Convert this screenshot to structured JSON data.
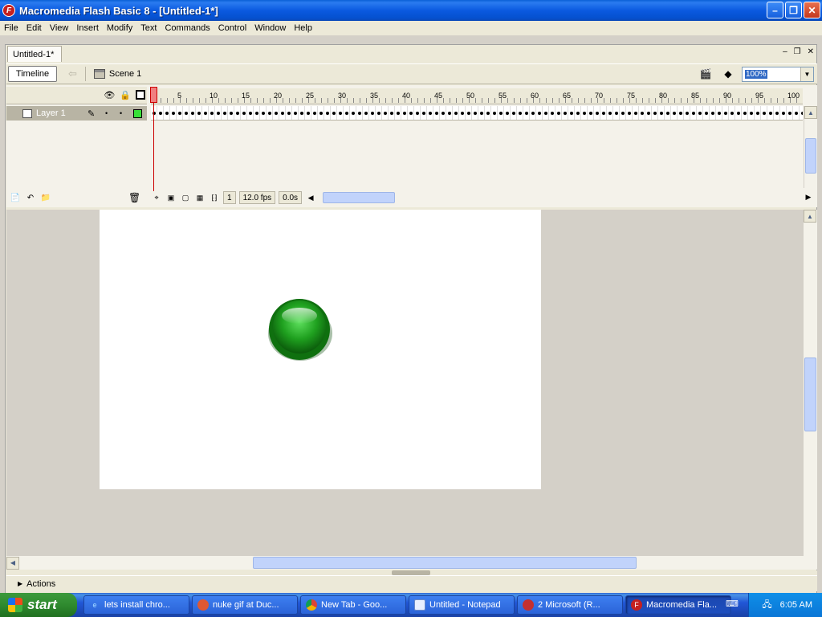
{
  "window": {
    "title": "Macromedia Flash Basic 8 - [Untitled-1*]",
    "app_icon": "F",
    "minimize": "–",
    "maximize": "❐",
    "close": "✕"
  },
  "menu": [
    "File",
    "Edit",
    "View",
    "Insert",
    "Modify",
    "Text",
    "Commands",
    "Control",
    "Window",
    "Help"
  ],
  "document": {
    "tab_label": "Untitled-1*",
    "minimize": "–",
    "restore": "❐",
    "close": "✕"
  },
  "edit_bar": {
    "timeline_label": "Timeline",
    "scene_label": "Scene 1",
    "zoom": "100%"
  },
  "timeline": {
    "layer_name": "Layer 1",
    "ruler_numbers": [
      "1",
      "5",
      "10",
      "15",
      "20",
      "25",
      "30",
      "35",
      "40",
      "45",
      "50",
      "55",
      "60",
      "65",
      "70",
      "75",
      "80",
      "85",
      "90",
      "95",
      "100"
    ],
    "current_frame": "1",
    "frame_rate": "12.0 fps",
    "elapsed": "0.0s"
  },
  "panels": {
    "actions_label": "Actions"
  },
  "taskbar": {
    "start_label": "start",
    "tasks": [
      {
        "label": "lets install chro...",
        "icon": "ie-icon"
      },
      {
        "label": "nuke gif at Duc...",
        "icon": "duck-icon"
      },
      {
        "label": "New Tab - Goo...",
        "icon": "chrome-icon"
      },
      {
        "label": "Untitled - Notepad",
        "icon": "notepad-icon"
      },
      {
        "label": "2 Microsoft (R...",
        "icon": "ms-icon"
      },
      {
        "label": "Macromedia Fla...",
        "icon": "flash-icon"
      }
    ],
    "clock": "6:05 AM"
  },
  "colors": {
    "stage": "#ffffff",
    "button_green": "#1fa01f",
    "taskbar": "#2157d7",
    "start": "#2f8a2f"
  }
}
